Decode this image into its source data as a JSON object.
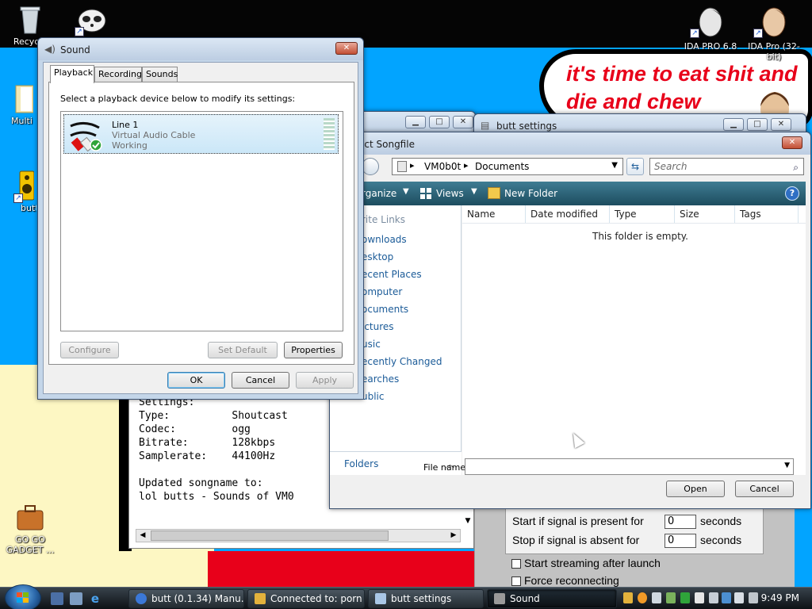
{
  "desktop": {
    "bubble_text": "it's time to eat shit and die and chew",
    "icons": {
      "recycle": "Recycle",
      "multi": "Multi",
      "butt": "butt",
      "gogo": "GO GO GADGET ...",
      "ida1": "IDA PRO 6.8",
      "ida2": "IDA Pro (32-bit)"
    }
  },
  "sound": {
    "title": "Sound",
    "tabs": [
      "Playback",
      "Recording",
      "Sounds"
    ],
    "instruction": "Select a playback device below to modify its settings:",
    "device": {
      "name": "Line 1",
      "desc": "Virtual Audio Cable",
      "status": "Working"
    },
    "buttons": {
      "configure": "Configure",
      "set_default": "Set Default",
      "properties": "Properties",
      "ok": "OK",
      "cancel": "Cancel",
      "apply": "Apply"
    }
  },
  "songfile": {
    "title": "ect Songfile",
    "path": [
      "VM0b0t",
      "Documents"
    ],
    "search_placeholder": "Search",
    "cmd": {
      "organize": "rganize",
      "views": "Views",
      "new_folder": "New Folder"
    },
    "nav_header": "rite Links",
    "nav_links": [
      "ownloads",
      "esktop",
      "ecent Places",
      "omputer",
      "ocuments",
      "ictures",
      "usic",
      "ecently Changed",
      "earches",
      "ublic"
    ],
    "folders_label": "Folders",
    "columns": [
      "Name",
      "Date modified",
      "Type",
      "Size",
      "Tags"
    ],
    "empty_msg": "This folder is empty.",
    "filename_label": "File name:",
    "filename_value": "",
    "open": "Open",
    "cancel": "Cancel"
  },
  "butt_settings": {
    "title": "butt settings",
    "start_label": "Start if signal is present for",
    "start_value": "0",
    "stop_label": "Stop if signal is absent for",
    "stop_value": "0",
    "seconds": "seconds",
    "start_streaming": "Start streaming after launch",
    "force_reconnect": "Force reconnecting"
  },
  "log": {
    "lines": "Settings:\nType:          Shoutcast\nCodec:         ogg\nBitrate:       128kbps\nSamplerate:    44100Hz\n\nUpdated songname to:\nlol butts - Sounds of VM0"
  },
  "taskbar": {
    "items": [
      {
        "label": "butt (0.1.34) Manu...",
        "color": "#3b78d8"
      },
      {
        "label": "Connected to: porn",
        "color": "#e3b23c"
      },
      {
        "label": "butt settings",
        "color": "#a9c7e6"
      },
      {
        "label": "Sound",
        "color": "#9a9a9a"
      }
    ],
    "clock": "9:49 PM"
  }
}
